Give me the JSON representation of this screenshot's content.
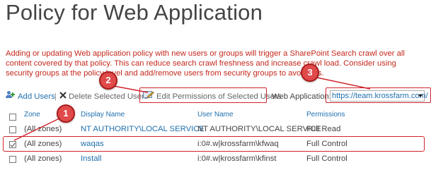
{
  "page": {
    "title": "Policy for Web Application"
  },
  "warning_text": "Adding or updating Web application policy with new users or groups will trigger a SharePoint Search crawl over all content covered by that policy. This can reduce search crawl freshness and increase crawl load. Consider using security groups at the policy level and add/remove users from security groups to avoid this.",
  "toolbar": {
    "add_users": "Add Users",
    "separator": "|",
    "delete_selected": "Delete Selected Users",
    "edit_permissions": "Edit Permissions of Selected Users",
    "web_app_label": "Web Application:",
    "web_app_value": "https://team.krossfarm.com/"
  },
  "grid": {
    "headers": {
      "zone": "Zone",
      "display_name": "Display Name",
      "user_name": "User Name",
      "permissions": "Permissions"
    },
    "rows": [
      {
        "checked": false,
        "zone": "(All zones)",
        "display_name": "NT AUTHORITY\\LOCAL SERVICE",
        "user_name": "NT AUTHORITY\\LOCAL SERVICE",
        "permissions": "Full Read"
      },
      {
        "checked": true,
        "zone": "(All zones)",
        "display_name": "waqas",
        "user_name": "i:0#.w|krossfarm\\kfwaq",
        "permissions": "Full Control"
      },
      {
        "checked": false,
        "zone": "(All zones)",
        "display_name": "Install",
        "user_name": "i:0#.w|krossfarm\\kfinst",
        "permissions": "Full Control"
      }
    ]
  },
  "callouts": [
    "1",
    "2",
    "3"
  ],
  "colors": {
    "accent": "#1f6fae",
    "warning": "#c4281c",
    "annotation": "#d1242d"
  },
  "icons": [
    "add-users-icon",
    "delete-x-icon",
    "edit-permissions-icon",
    "dropdown-arrow-icon",
    "checkbox-icon"
  ]
}
